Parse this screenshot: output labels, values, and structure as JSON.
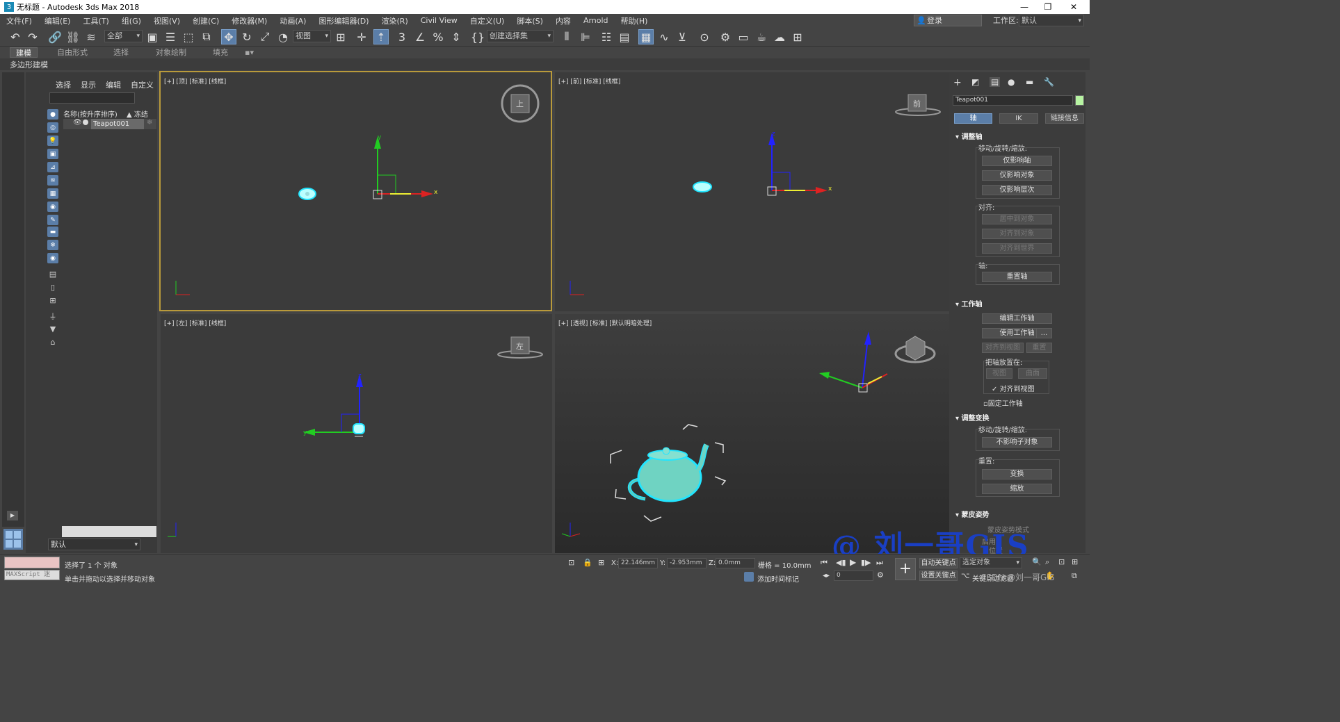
{
  "window": {
    "title": "无标题 - Autodesk 3ds Max 2018",
    "minimize": "—",
    "maximize": "❐",
    "close": "✕"
  },
  "menu": [
    "文件(F)",
    "编辑(E)",
    "工具(T)",
    "组(G)",
    "视图(V)",
    "创建(C)",
    "修改器(M)",
    "动画(A)",
    "图形编辑器(D)",
    "渲染(R)",
    "Civil View",
    "自定义(U)",
    "脚本(S)",
    "内容",
    "Arnold",
    "帮助(H)"
  ],
  "account": {
    "login": "登录",
    "workspace_label": "工作区:",
    "workspace_value": "默认"
  },
  "toolbar": {
    "filter_dropdown": "全部",
    "refcoord_dropdown": "视图",
    "selection_set": "创建选择集"
  },
  "ribbon": {
    "tabs": [
      "建模",
      "自由形式",
      "选择",
      "对象绘制",
      "填充"
    ],
    "active_tab": "建模",
    "sub_label": "多边形建模"
  },
  "scene_explorer": {
    "tabs": [
      "选择",
      "显示",
      "编辑",
      "自定义"
    ],
    "column_name": "名称(按升序排序)",
    "column_frozen": "▲ 冻结",
    "objects": [
      "Teapot001"
    ],
    "layer_dropdown": "默认"
  },
  "viewports": {
    "top": "[+] [顶] [标准] [线框]",
    "front": "[+] [前] [标准] [线框]",
    "left": "[+] [左] [标准] [线框]",
    "perspective": "[+] [透视] [标准] [默认明暗处理]",
    "viewcube_top": "上",
    "viewcube_front": "前",
    "viewcube_left": "左",
    "axis_x": "x",
    "axis_y": "y",
    "axis_z": "z"
  },
  "command_panel": {
    "object_name": "Teapot001",
    "tabs": [
      "轴",
      "IK",
      "链接信息"
    ],
    "adjust_pivot": {
      "title": "调整轴",
      "move_rotate_scale": "移动/旋转/缩放:",
      "buttons": [
        "仅影响轴",
        "仅影响对象",
        "仅影响层次"
      ],
      "align_label": "对齐:",
      "align_buttons": [
        "居中到对象",
        "对齐到对象",
        "对齐到世界"
      ],
      "pivot_label": "轴:",
      "reset_pivot": "重置轴"
    },
    "working_pivot": {
      "title": "工作轴",
      "edit": "编辑工作轴",
      "use": "使用工作轴",
      "more": "...",
      "align_to_view": "对齐到视图",
      "reset": "重置",
      "place_label": "把轴放置在:",
      "view": "视图",
      "surface": "曲面",
      "align_to_view_check": "对齐到视图",
      "fix_working_pivot": "固定工作轴"
    },
    "adjust_transform": {
      "title": "调整变换",
      "move_rotate_scale": "移动/旋转/缩放:",
      "dont_affect_children": "不影响子对象",
      "reset_label": "重置:",
      "transform": "变换",
      "scale": "缩放"
    },
    "skin_pose": {
      "title": "蒙皮姿势",
      "mode": "蒙皮姿势模式",
      "enable": "启用",
      "position": "位置"
    }
  },
  "status": {
    "maxscript": "MAXScript 迷",
    "selected": "选择了 1 个 对象",
    "hint": "单击并拖动以选择并移动对象",
    "x_label": "X:",
    "x_value": "22.146mm",
    "y_label": "Y:",
    "y_value": "-2.953mm",
    "z_label": "Z:",
    "z_value": "0.0mm",
    "grid": "栅格 = 10.0mm",
    "add_time_tag": "添加时间标记",
    "auto_key": "自动关键点",
    "set_key": "设置关键点",
    "selected_object": "选定对象",
    "key_filters": "关键点过滤器",
    "frame": "0"
  },
  "watermark": "@ 刘一哥GIS",
  "csdn": "CSDN @刘一哥GIS",
  "colors": {
    "accent_blue": "#5b7ea8",
    "active_viewport": "#b99a3b",
    "teapot": "#6fd3c2",
    "select_cyan": "#22e5ff"
  }
}
